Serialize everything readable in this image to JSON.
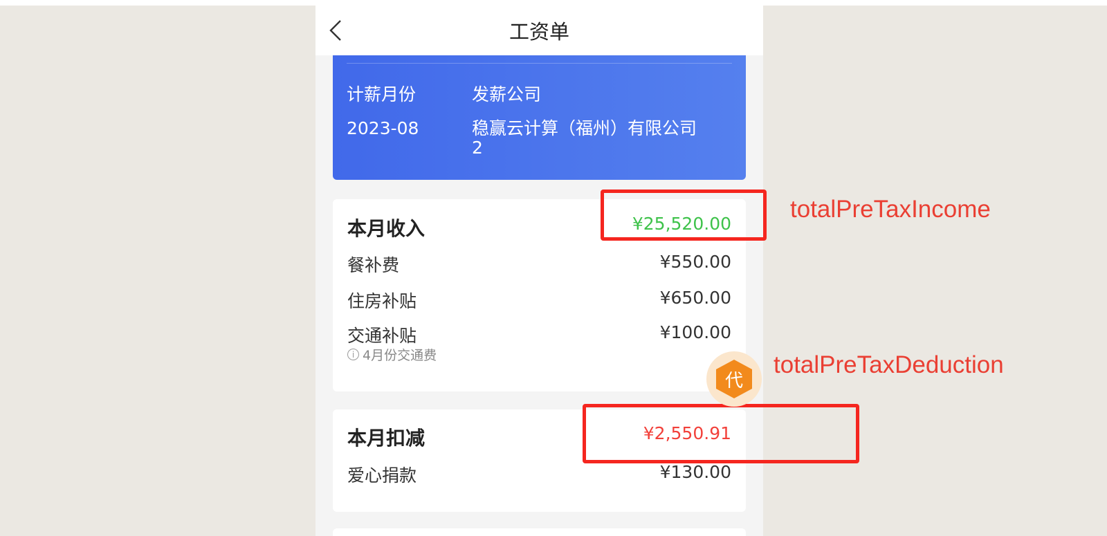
{
  "nav": {
    "title": "工资单",
    "back_icon": "chevron-left-icon"
  },
  "salary_info": {
    "month_label": "计薪月份",
    "month_value": "2023-08",
    "company_label": "发薪公司",
    "company_value_line1": "稳赢云计算（福州）有限公司",
    "company_value_line2": "2"
  },
  "income": {
    "title": "本月收入",
    "total": "¥25,520.00",
    "total_color": "#3ec24a",
    "items": [
      {
        "label": "餐补费",
        "value": "¥550.00"
      },
      {
        "label": "住房补贴",
        "value": "¥650.00"
      },
      {
        "label": "交通补贴",
        "value": "¥100.00",
        "note": "4月份交通费"
      }
    ]
  },
  "deduction": {
    "title": "本月扣减",
    "total": "¥2,550.91",
    "total_color": "#f2403a",
    "items": [
      {
        "label": "爱心捐款",
        "value": "¥130.00"
      }
    ]
  },
  "annotations": {
    "income_label": "totalPreTaxIncome",
    "deduction_label": "totalPreTaxDeduction"
  },
  "float_badge": {
    "text": "代",
    "icon": "hexagon-badge-icon"
  },
  "colors": {
    "blue_card": "#4169ea",
    "annotation_red": "#f5261f",
    "badge_orange": "#f28a1c"
  }
}
